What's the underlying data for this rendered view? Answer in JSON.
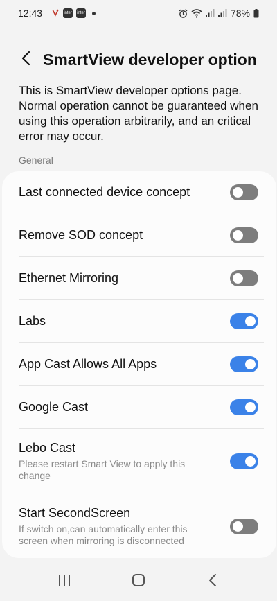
{
  "status": {
    "time": "12:43",
    "badges": [
      "inter",
      "inter"
    ],
    "battery": "78%"
  },
  "header": {
    "title": "SmartView developer option"
  },
  "description": "This is SmartView developer options page. Normal operation cannot be guaranteed when using this operation arbitrarily, and an critical error may occur.",
  "section_label": "General",
  "settings": [
    {
      "label": "Last connected device concept",
      "sub": "",
      "enabled": false
    },
    {
      "label": "Remove SOD concept",
      "sub": "",
      "enabled": false
    },
    {
      "label": "Ethernet Mirroring",
      "sub": "",
      "enabled": false
    },
    {
      "label": "Labs",
      "sub": "",
      "enabled": true
    },
    {
      "label": "App Cast Allows All Apps",
      "sub": "",
      "enabled": true
    },
    {
      "label": "Google Cast",
      "sub": "",
      "enabled": true
    },
    {
      "label": "Lebo Cast",
      "sub": "Please restart Smart View to apply this change",
      "enabled": true
    },
    {
      "label": "Start SecondScreen",
      "sub": "If switch on,can automatically enter this screen when mirroring is disconnected",
      "enabled": false
    }
  ],
  "colors": {
    "accent": "#3b82e8",
    "toggle_off": "#7d7d7d",
    "background": "#f3f3f3",
    "card": "#fcfcfc"
  },
  "icons": {
    "back": "chevron-left-icon",
    "nav_recents": "recents-icon",
    "nav_home": "home-icon",
    "nav_back": "back-icon"
  }
}
